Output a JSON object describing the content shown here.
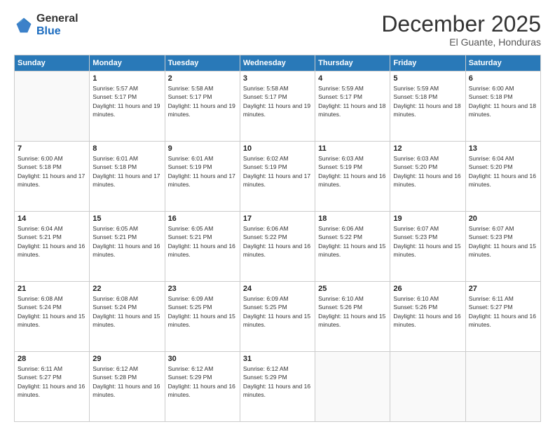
{
  "header": {
    "logo_general": "General",
    "logo_blue": "Blue",
    "month_title": "December 2025",
    "location": "El Guante, Honduras"
  },
  "weekdays": [
    "Sunday",
    "Monday",
    "Tuesday",
    "Wednesday",
    "Thursday",
    "Friday",
    "Saturday"
  ],
  "weeks": [
    [
      {
        "day": "",
        "sunrise": "",
        "sunset": "",
        "daylight": "",
        "empty": true
      },
      {
        "day": "1",
        "sunrise": "Sunrise: 5:57 AM",
        "sunset": "Sunset: 5:17 PM",
        "daylight": "Daylight: 11 hours and 19 minutes.",
        "empty": false
      },
      {
        "day": "2",
        "sunrise": "Sunrise: 5:58 AM",
        "sunset": "Sunset: 5:17 PM",
        "daylight": "Daylight: 11 hours and 19 minutes.",
        "empty": false
      },
      {
        "day": "3",
        "sunrise": "Sunrise: 5:58 AM",
        "sunset": "Sunset: 5:17 PM",
        "daylight": "Daylight: 11 hours and 19 minutes.",
        "empty": false
      },
      {
        "day": "4",
        "sunrise": "Sunrise: 5:59 AM",
        "sunset": "Sunset: 5:17 PM",
        "daylight": "Daylight: 11 hours and 18 minutes.",
        "empty": false
      },
      {
        "day": "5",
        "sunrise": "Sunrise: 5:59 AM",
        "sunset": "Sunset: 5:18 PM",
        "daylight": "Daylight: 11 hours and 18 minutes.",
        "empty": false
      },
      {
        "day": "6",
        "sunrise": "Sunrise: 6:00 AM",
        "sunset": "Sunset: 5:18 PM",
        "daylight": "Daylight: 11 hours and 18 minutes.",
        "empty": false
      }
    ],
    [
      {
        "day": "7",
        "sunrise": "Sunrise: 6:00 AM",
        "sunset": "Sunset: 5:18 PM",
        "daylight": "Daylight: 11 hours and 17 minutes.",
        "empty": false
      },
      {
        "day": "8",
        "sunrise": "Sunrise: 6:01 AM",
        "sunset": "Sunset: 5:18 PM",
        "daylight": "Daylight: 11 hours and 17 minutes.",
        "empty": false
      },
      {
        "day": "9",
        "sunrise": "Sunrise: 6:01 AM",
        "sunset": "Sunset: 5:19 PM",
        "daylight": "Daylight: 11 hours and 17 minutes.",
        "empty": false
      },
      {
        "day": "10",
        "sunrise": "Sunrise: 6:02 AM",
        "sunset": "Sunset: 5:19 PM",
        "daylight": "Daylight: 11 hours and 17 minutes.",
        "empty": false
      },
      {
        "day": "11",
        "sunrise": "Sunrise: 6:03 AM",
        "sunset": "Sunset: 5:19 PM",
        "daylight": "Daylight: 11 hours and 16 minutes.",
        "empty": false
      },
      {
        "day": "12",
        "sunrise": "Sunrise: 6:03 AM",
        "sunset": "Sunset: 5:20 PM",
        "daylight": "Daylight: 11 hours and 16 minutes.",
        "empty": false
      },
      {
        "day": "13",
        "sunrise": "Sunrise: 6:04 AM",
        "sunset": "Sunset: 5:20 PM",
        "daylight": "Daylight: 11 hours and 16 minutes.",
        "empty": false
      }
    ],
    [
      {
        "day": "14",
        "sunrise": "Sunrise: 6:04 AM",
        "sunset": "Sunset: 5:21 PM",
        "daylight": "Daylight: 11 hours and 16 minutes.",
        "empty": false
      },
      {
        "day": "15",
        "sunrise": "Sunrise: 6:05 AM",
        "sunset": "Sunset: 5:21 PM",
        "daylight": "Daylight: 11 hours and 16 minutes.",
        "empty": false
      },
      {
        "day": "16",
        "sunrise": "Sunrise: 6:05 AM",
        "sunset": "Sunset: 5:21 PM",
        "daylight": "Daylight: 11 hours and 16 minutes.",
        "empty": false
      },
      {
        "day": "17",
        "sunrise": "Sunrise: 6:06 AM",
        "sunset": "Sunset: 5:22 PM",
        "daylight": "Daylight: 11 hours and 16 minutes.",
        "empty": false
      },
      {
        "day": "18",
        "sunrise": "Sunrise: 6:06 AM",
        "sunset": "Sunset: 5:22 PM",
        "daylight": "Daylight: 11 hours and 15 minutes.",
        "empty": false
      },
      {
        "day": "19",
        "sunrise": "Sunrise: 6:07 AM",
        "sunset": "Sunset: 5:23 PM",
        "daylight": "Daylight: 11 hours and 15 minutes.",
        "empty": false
      },
      {
        "day": "20",
        "sunrise": "Sunrise: 6:07 AM",
        "sunset": "Sunset: 5:23 PM",
        "daylight": "Daylight: 11 hours and 15 minutes.",
        "empty": false
      }
    ],
    [
      {
        "day": "21",
        "sunrise": "Sunrise: 6:08 AM",
        "sunset": "Sunset: 5:24 PM",
        "daylight": "Daylight: 11 hours and 15 minutes.",
        "empty": false
      },
      {
        "day": "22",
        "sunrise": "Sunrise: 6:08 AM",
        "sunset": "Sunset: 5:24 PM",
        "daylight": "Daylight: 11 hours and 15 minutes.",
        "empty": false
      },
      {
        "day": "23",
        "sunrise": "Sunrise: 6:09 AM",
        "sunset": "Sunset: 5:25 PM",
        "daylight": "Daylight: 11 hours and 15 minutes.",
        "empty": false
      },
      {
        "day": "24",
        "sunrise": "Sunrise: 6:09 AM",
        "sunset": "Sunset: 5:25 PM",
        "daylight": "Daylight: 11 hours and 15 minutes.",
        "empty": false
      },
      {
        "day": "25",
        "sunrise": "Sunrise: 6:10 AM",
        "sunset": "Sunset: 5:26 PM",
        "daylight": "Daylight: 11 hours and 15 minutes.",
        "empty": false
      },
      {
        "day": "26",
        "sunrise": "Sunrise: 6:10 AM",
        "sunset": "Sunset: 5:26 PM",
        "daylight": "Daylight: 11 hours and 16 minutes.",
        "empty": false
      },
      {
        "day": "27",
        "sunrise": "Sunrise: 6:11 AM",
        "sunset": "Sunset: 5:27 PM",
        "daylight": "Daylight: 11 hours and 16 minutes.",
        "empty": false
      }
    ],
    [
      {
        "day": "28",
        "sunrise": "Sunrise: 6:11 AM",
        "sunset": "Sunset: 5:27 PM",
        "daylight": "Daylight: 11 hours and 16 minutes.",
        "empty": false
      },
      {
        "day": "29",
        "sunrise": "Sunrise: 6:12 AM",
        "sunset": "Sunset: 5:28 PM",
        "daylight": "Daylight: 11 hours and 16 minutes.",
        "empty": false
      },
      {
        "day": "30",
        "sunrise": "Sunrise: 6:12 AM",
        "sunset": "Sunset: 5:29 PM",
        "daylight": "Daylight: 11 hours and 16 minutes.",
        "empty": false
      },
      {
        "day": "31",
        "sunrise": "Sunrise: 6:12 AM",
        "sunset": "Sunset: 5:29 PM",
        "daylight": "Daylight: 11 hours and 16 minutes.",
        "empty": false
      },
      {
        "day": "",
        "sunrise": "",
        "sunset": "",
        "daylight": "",
        "empty": true
      },
      {
        "day": "",
        "sunrise": "",
        "sunset": "",
        "daylight": "",
        "empty": true
      },
      {
        "day": "",
        "sunrise": "",
        "sunset": "",
        "daylight": "",
        "empty": true
      }
    ]
  ]
}
